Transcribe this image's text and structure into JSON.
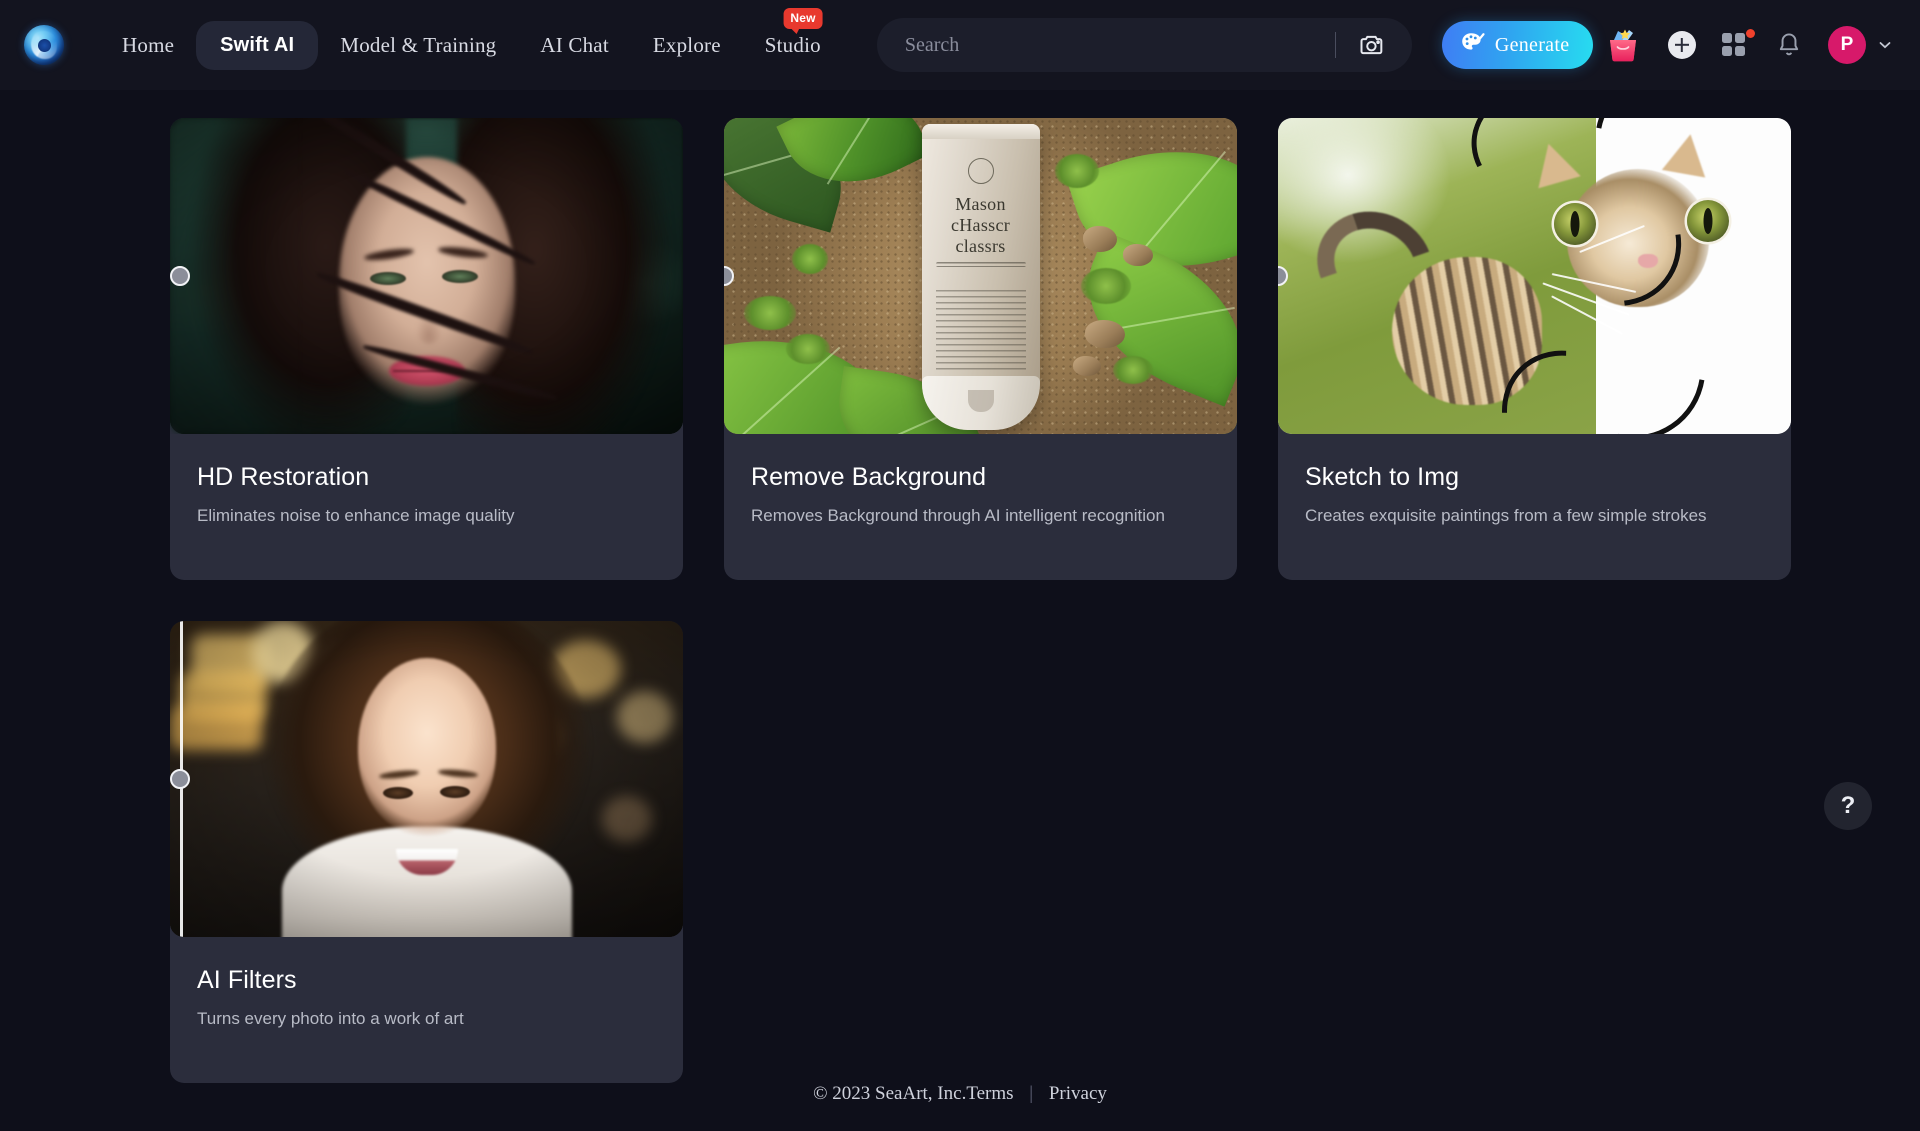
{
  "header": {
    "logo_name": "seaart-logo",
    "nav": [
      {
        "label": "Home",
        "active": false,
        "badge": null
      },
      {
        "label": "Swift AI",
        "active": true,
        "badge": null
      },
      {
        "label": "Model & Training",
        "active": false,
        "badge": null
      },
      {
        "label": "AI Chat",
        "active": false,
        "badge": null
      },
      {
        "label": "Explore",
        "active": false,
        "badge": null
      },
      {
        "label": "Studio",
        "active": false,
        "badge": "New"
      }
    ],
    "search": {
      "placeholder": "Search",
      "value": "",
      "camera_icon": "camera-icon"
    },
    "generate": {
      "label": "Generate",
      "icon": "palette-brush-icon",
      "gradient_from": "#3f7df4",
      "gradient_to": "#27dcf0"
    },
    "icons": {
      "gift": "gift-bag-icon",
      "plus": "plus-circle-icon",
      "apps": "apps-grid-icon",
      "apps_dot_color": "#f0412c",
      "bell": "notification-bell-icon",
      "chevron": "chevron-down-icon"
    },
    "avatar": {
      "initial": "P",
      "color": "#d7196a"
    }
  },
  "main": {
    "cards": [
      {
        "title": "HD Restoration",
        "description": "Eliminates noise to enhance image quality",
        "art": "portrait",
        "slider_percent": 2
      },
      {
        "title": "Remove Background",
        "description": "Removes Background through AI intelligent recognition",
        "art": "tube",
        "slider_percent": 0
      },
      {
        "title": "Sketch to Img",
        "description": "Creates exquisite paintings from a few simple strokes",
        "art": "cat",
        "slider_percent": 0
      },
      {
        "title": "AI Filters",
        "description": "Turns every photo into a work of art",
        "art": "girl",
        "slider_percent": 2
      }
    ]
  },
  "footer": {
    "copyright": "© 2023 SeaArt, Inc.Terms",
    "separator": "|",
    "privacy": "Privacy"
  },
  "help": {
    "label": "?"
  }
}
